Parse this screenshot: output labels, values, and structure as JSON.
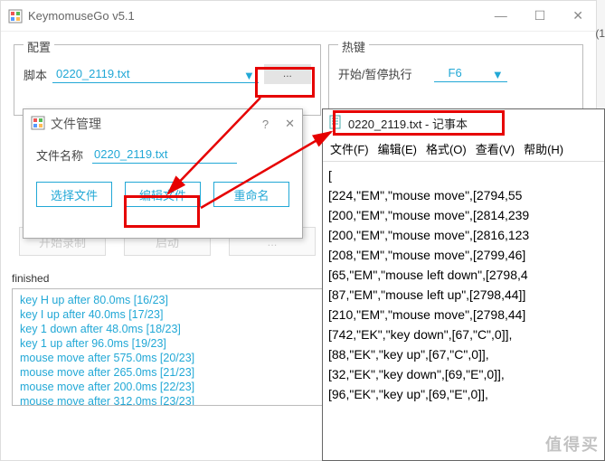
{
  "window": {
    "title": "KeymomuseGo v5.1",
    "min": "—",
    "max": "☐",
    "close": "✕"
  },
  "panels": {
    "config_title": "配置",
    "config_label": "脚本",
    "script_selected": "0220_2119.txt",
    "dots": "...",
    "hotkey_title": "热键",
    "hotkey_label": "开始/暂停执行",
    "hotkey_value": "F6"
  },
  "ghost_buttons": [
    "开始录制",
    "启动",
    "..."
  ],
  "status": "finished",
  "log": [
    "key H up after 80.0ms [16/23]",
    "key I up after 40.0ms [17/23]",
    "key 1 down after 48.0ms [18/23]",
    "key 1 up after 96.0ms [19/23]",
    "mouse move after 575.0ms [20/23]",
    "mouse move after 265.0ms [21/23]",
    "mouse move after 200.0ms [22/23]",
    "mouse move after 312.0ms [23/23]"
  ],
  "dialog": {
    "title": "文件管理",
    "qmark": "?",
    "close": "✕",
    "file_label": "文件名称",
    "file_value": "0220_2119.txt",
    "buttons": [
      "选择文件",
      "编辑文件",
      "重命名"
    ]
  },
  "notepad": {
    "caption": "0220_2119.txt - 记事本",
    "menu": [
      "文件(F)",
      "编辑(E)",
      "格式(O)",
      "查看(V)",
      "帮助(H)"
    ],
    "lines": [
      "[",
      "[224,\"EM\",\"mouse move\",[2794,55",
      "[200,\"EM\",\"mouse move\",[2814,239",
      "[200,\"EM\",\"mouse move\",[2816,123",
      "[208,\"EM\",\"mouse move\",[2799,46]",
      "[65,\"EM\",\"mouse left down\",[2798,4",
      "[87,\"EM\",\"mouse left up\",[2798,44]]",
      "[210,\"EM\",\"mouse move\",[2798,44]",
      "[742,\"EK\",\"key down\",[67,\"C\",0]],",
      "[88,\"EK\",\"key up\",[67,\"C\",0]],",
      "[32,\"EK\",\"key down\",[69,\"E\",0]],",
      "[96,\"EK\",\"key up\",[69,\"E\",0]],"
    ]
  },
  "right_edge": "(1",
  "watermark": "值得买"
}
